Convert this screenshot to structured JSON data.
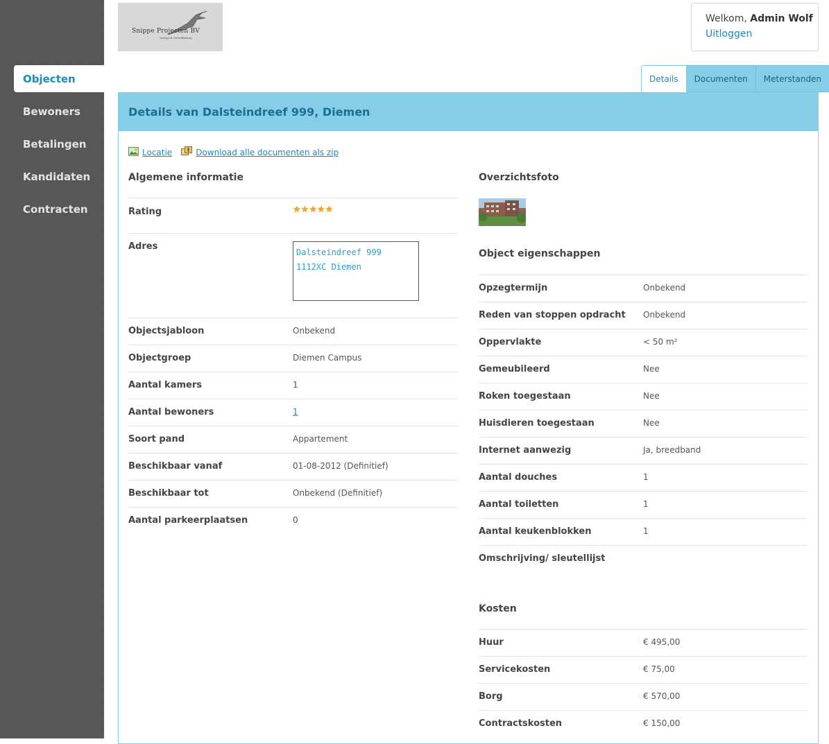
{
  "sidebar": {
    "items": [
      {
        "label": "Objecten",
        "active": true
      },
      {
        "label": "Bewoners",
        "active": false
      },
      {
        "label": "Betalingen",
        "active": false
      },
      {
        "label": "Kandidaten",
        "active": false
      },
      {
        "label": "Contracten",
        "active": false
      }
    ]
  },
  "header": {
    "logo_text": "Snippe Projecten BV",
    "logo_sub": "Vastgoed Ontwikkeling",
    "welcome_prefix": "Welkom,",
    "user_name": "Admin Wolf",
    "logout_label": "Uitloggen"
  },
  "tabs": [
    {
      "label": "Details",
      "active": true
    },
    {
      "label": "Documenten",
      "active": false
    },
    {
      "label": "Meterstanden",
      "active": false
    }
  ],
  "panel": {
    "title": "Details van Dalsteindreef 999, Diemen",
    "actions": {
      "location_label": "Locatie",
      "download_label": "Download alle documenten als zip"
    },
    "general": {
      "title": "Algemene informatie",
      "rating_label": "Rating",
      "rating_value": 5,
      "address_label": "Adres",
      "address_text": "Dalsteindreef 999\n1112XC Diemen",
      "rows": [
        {
          "label": "Objectsjabloon",
          "value": "Onbekend"
        },
        {
          "label": "Objectgroep",
          "value": "Diemen Campus"
        },
        {
          "label": "Aantal kamers",
          "value": "1"
        },
        {
          "label": "Aantal bewoners",
          "value": "1",
          "link": true
        },
        {
          "label": "Soort pand",
          "value": "Appartement"
        },
        {
          "label": "Beschikbaar vanaf",
          "value": "01-08-2012 (Definitief)"
        },
        {
          "label": "Beschikbaar tot",
          "value": "Onbekend (Definitief)"
        },
        {
          "label": "Aantal parkeerplaatsen",
          "value": "0"
        }
      ]
    },
    "photo": {
      "title": "Overzichtsfoto"
    },
    "properties": {
      "title": "Object eigenschappen",
      "rows": [
        {
          "label": "Opzegtermijn",
          "value": "Onbekend"
        },
        {
          "label": "Reden van stoppen opdracht",
          "value": "Onbekend"
        },
        {
          "label": "Oppervlakte",
          "value": "< 50 m²"
        },
        {
          "label": "Gemeubileerd",
          "value": "Nee"
        },
        {
          "label": "Roken toegestaan",
          "value": "Nee"
        },
        {
          "label": "Huisdieren toegestaan",
          "value": "Nee"
        },
        {
          "label": "Internet aanwezig",
          "value": "Ja, breedband"
        },
        {
          "label": "Aantal douches",
          "value": "1"
        },
        {
          "label": "Aantal toiletten",
          "value": "1"
        },
        {
          "label": "Aantal keukenblokken",
          "value": "1"
        },
        {
          "label": "Omschrijving/ sleutellijst",
          "value": ""
        }
      ]
    },
    "costs": {
      "title": "Kosten",
      "rows": [
        {
          "label": "Huur",
          "value": "€ 495,00"
        },
        {
          "label": "Servicekosten",
          "value": "€ 75,00"
        },
        {
          "label": "Borg",
          "value": "€ 570,00"
        },
        {
          "label": "Contractskosten",
          "value": "€ 150,00"
        }
      ]
    }
  },
  "colors": {
    "accent": "#1a8cbf",
    "panel_header": "#86cee8",
    "sidebar": "#555555",
    "star": "#f5a623"
  }
}
